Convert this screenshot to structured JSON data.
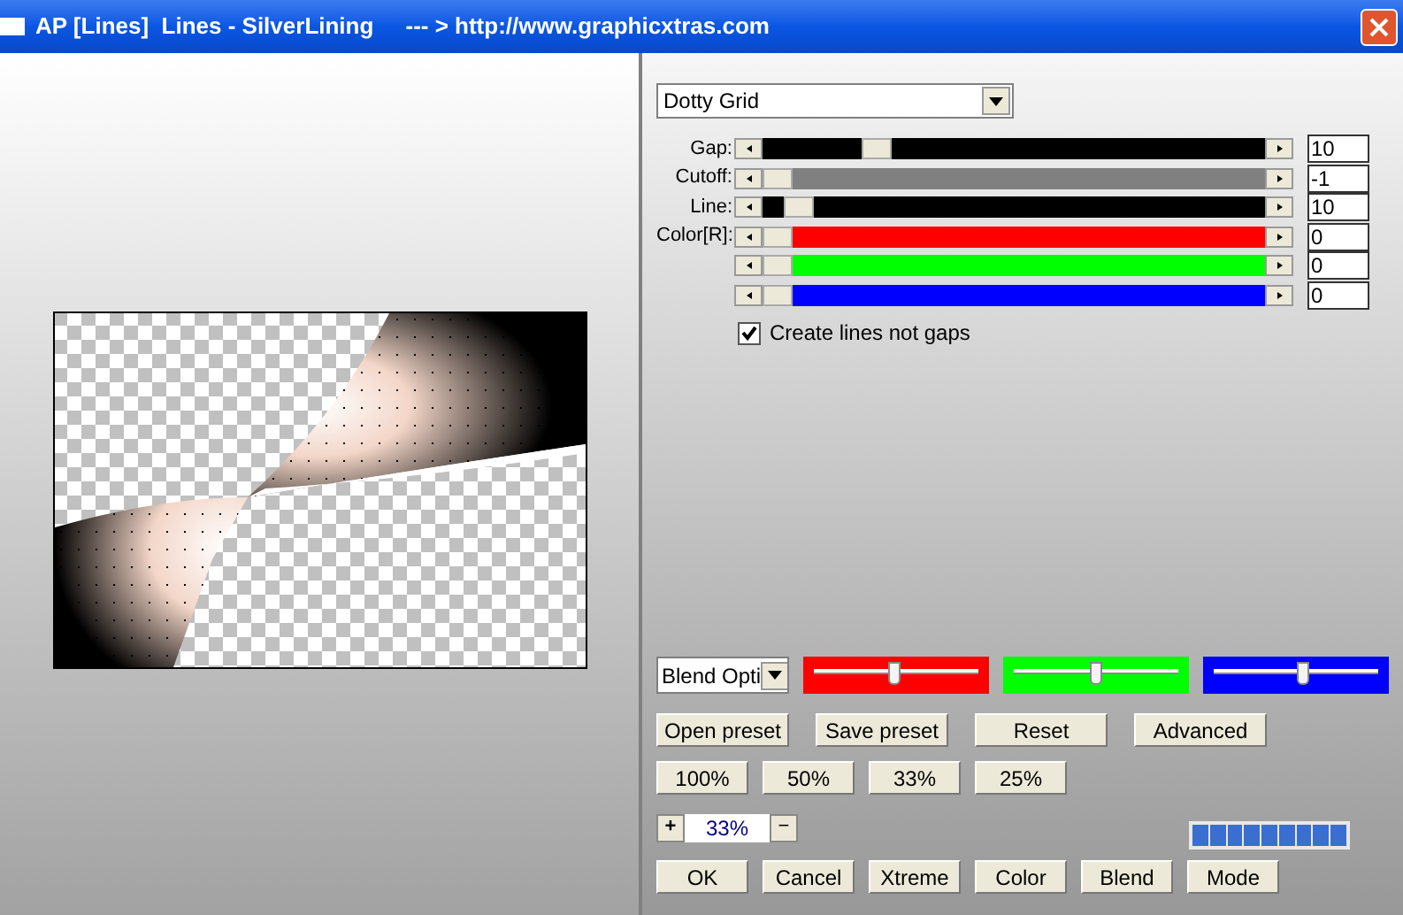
{
  "window": {
    "title": "AP [Lines]  Lines - SilverLining     --- > http://www.graphicxtras.com"
  },
  "effect_dropdown": {
    "value": "Dotty Grid"
  },
  "sliders": [
    {
      "label": "Gap:",
      "level": 0.21,
      "value": "10",
      "color": "#000000"
    },
    {
      "label": "Cutoff:",
      "level": 0,
      "value": "-1",
      "color": "#808080"
    },
    {
      "label": "Line:",
      "level": 0.045,
      "value": "10",
      "color": "#000000"
    },
    {
      "label": "Color[R]:",
      "level": 0,
      "value": "0",
      "color": "#ff0000"
    },
    {
      "level": 0,
      "value": "0",
      "color": "#00ff00"
    },
    {
      "level": 0,
      "value": "0",
      "color": "#0000ff"
    }
  ],
  "checkbox": {
    "label": "Create lines not gaps",
    "checked": true
  },
  "blend_dropdown": {
    "value": "Blend Opti"
  },
  "blend_sliders": [
    {
      "color": "#ff0000",
      "level": 0.49
    },
    {
      "color": "#00ff00",
      "level": 0.5
    },
    {
      "color": "#0000ff",
      "level": 0.55
    }
  ],
  "preset_buttons": [
    "Open preset",
    "Save preset",
    "Reset",
    "Advanced"
  ],
  "zoom_buttons": [
    "100%",
    "50%",
    "33%",
    "25%"
  ],
  "zoom": {
    "plus": "+",
    "value": "33%",
    "minus": "−"
  },
  "action_buttons": [
    "OK",
    "Cancel",
    "Xtreme",
    "Color",
    "Blend",
    "Mode"
  ]
}
